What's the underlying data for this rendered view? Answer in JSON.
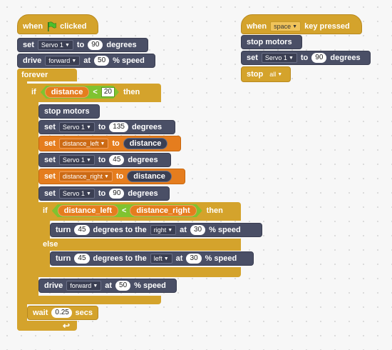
{
  "script1": {
    "hat": {
      "when": "when",
      "clicked": "clicked"
    },
    "set_servo": {
      "set": "set",
      "servo": "Servo 1",
      "to": "to",
      "value": "90",
      "degrees": "degrees"
    },
    "drive": {
      "drive": "drive",
      "dir": "forward",
      "at": "at",
      "value": "50",
      "speed": "% speed"
    },
    "forever": "forever",
    "if": "if",
    "cond": {
      "var": "distance",
      "op": "<",
      "value": "20"
    },
    "then": "then",
    "stop": "stop motors",
    "set135": {
      "set": "set",
      "servo": "Servo 1",
      "to": "to",
      "value": "135",
      "degrees": "degrees"
    },
    "set_dl": {
      "set": "set",
      "var": "distance_left",
      "to": "to",
      "value": "distance"
    },
    "set45": {
      "set": "set",
      "servo": "Servo 1",
      "to": "to",
      "value": "45",
      "degrees": "degrees"
    },
    "set_dr": {
      "set": "set",
      "var": "distance_right",
      "to": "to",
      "value": "distance"
    },
    "set90": {
      "set": "set",
      "servo": "Servo 1",
      "to": "to",
      "value": "90",
      "degrees": "degrees"
    },
    "if2": "if",
    "cond2": {
      "left": "distance_left",
      "op": "<",
      "right": "distance_right"
    },
    "then2": "then",
    "turn_right": {
      "turn": "turn",
      "deg": "45",
      "degrees_to_the": "degrees to the",
      "dir": "right",
      "at": "at",
      "speed": "30",
      "pct": "% speed"
    },
    "else": "else",
    "turn_left": {
      "turn": "turn",
      "deg": "45",
      "degrees_to_the": "degrees to the",
      "dir": "left",
      "at": "at",
      "speed": "30",
      "pct": "% speed"
    },
    "drive2": {
      "drive": "drive",
      "dir": "forward",
      "at": "at",
      "value": "50",
      "speed": "% speed"
    },
    "wait": {
      "wait": "wait",
      "value": "0.25",
      "secs": "secs"
    },
    "loop_arrow": "↩"
  },
  "script2": {
    "hat": {
      "when": "when",
      "key": "space",
      "pressed": "key pressed"
    },
    "stop": "stop motors",
    "set": {
      "set": "set",
      "servo": "Servo 1",
      "to": "to",
      "value": "90",
      "degrees": "degrees"
    },
    "stop_all": {
      "stop": "stop",
      "option": "all"
    }
  },
  "colors": {
    "events": "#d4a32c",
    "motors": "#4a4f66",
    "data": "#e57d1e",
    "operators": "#7fc330"
  },
  "icons": {
    "flag": "green-flag-icon",
    "dropdown": "dropdown-arrow-icon"
  }
}
